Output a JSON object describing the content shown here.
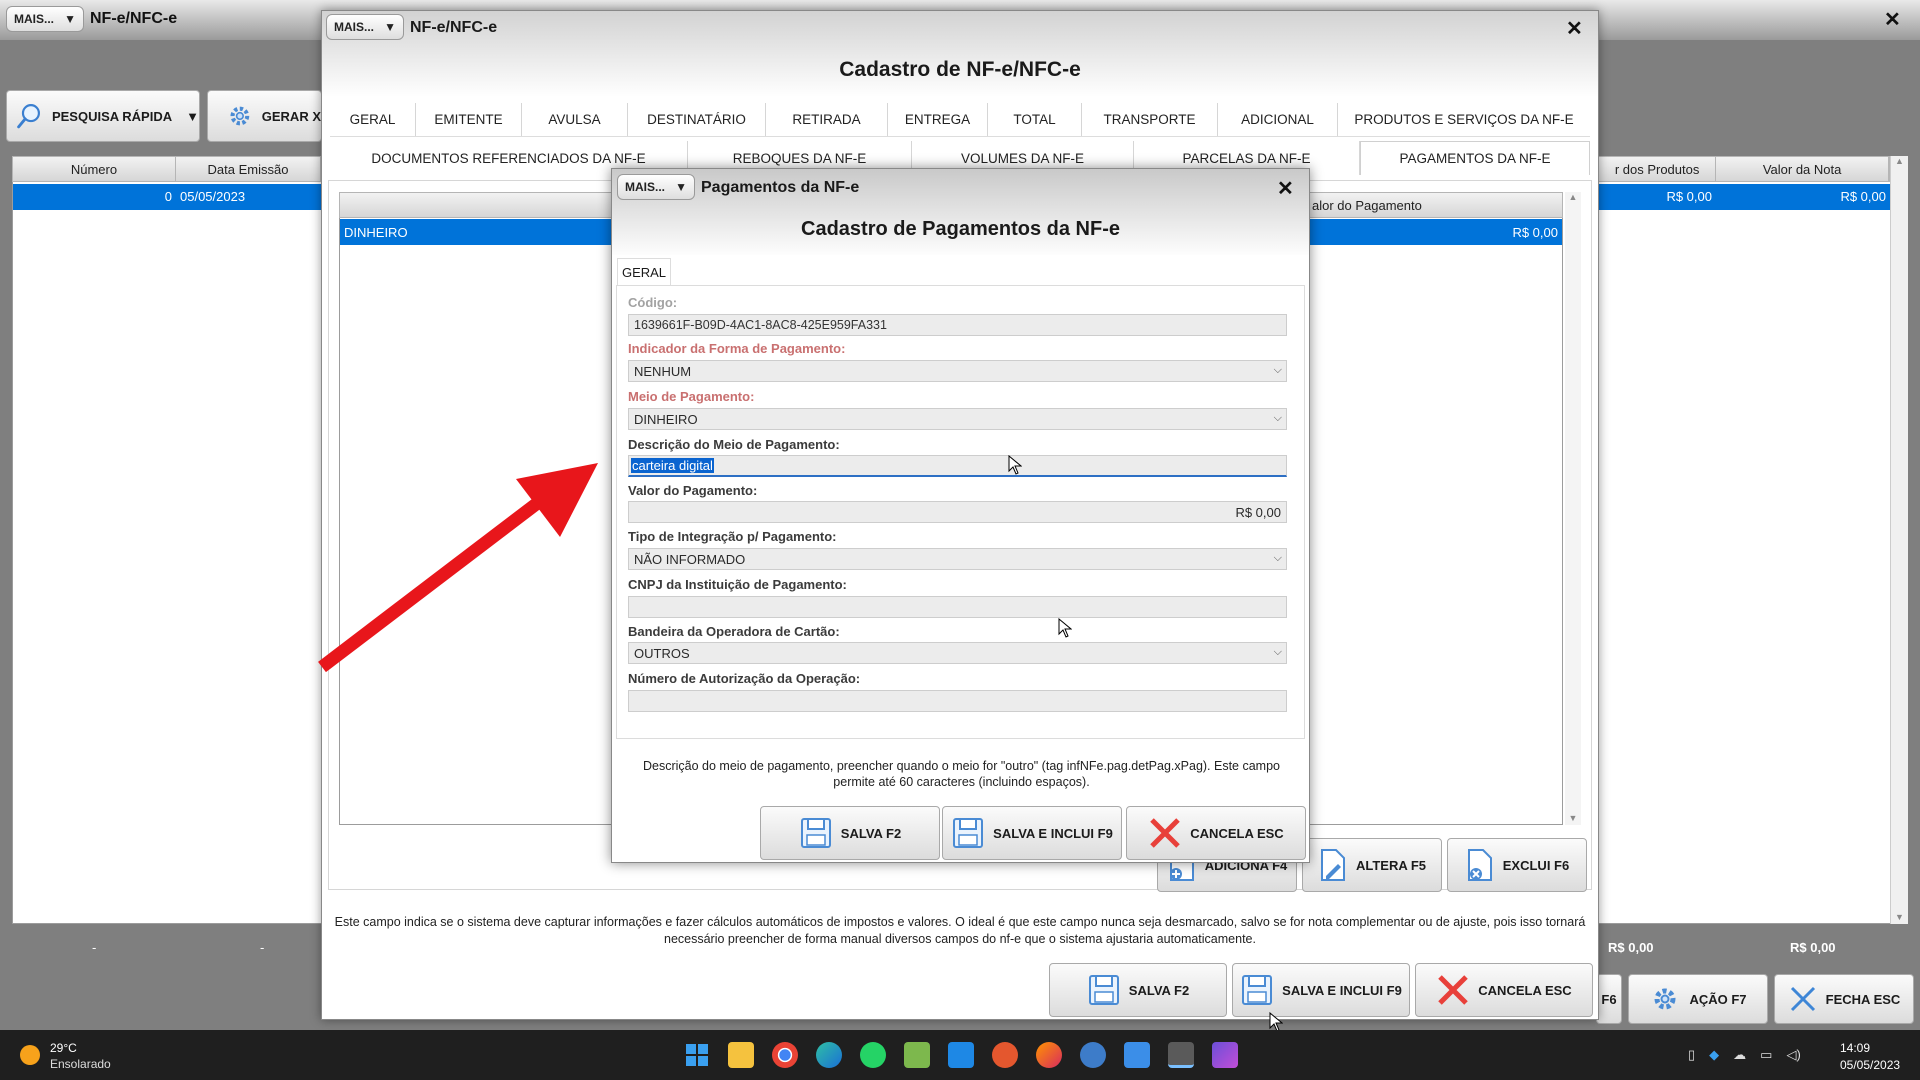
{
  "desktop": {
    "title": "NF-e/NFC-e",
    "mais": "MAIS...",
    "close": "✕"
  },
  "bg_toolbar": {
    "pesquisa": "PESQUISA RÁPIDA",
    "gerar": "GERAR X"
  },
  "bg_grid": {
    "headers": [
      "Número",
      "Data Emissão"
    ],
    "row": [
      "0",
      "05/05/2023"
    ],
    "right_headers": [
      "r dos Produtos",
      "Valor da Nota"
    ],
    "right_row": [
      "R$ 0,00",
      "R$ 0,00"
    ],
    "footer_left": [
      "-",
      "-"
    ],
    "footer_right": [
      "R$ 0,00",
      "R$ 0,00"
    ]
  },
  "bg_buttons": {
    "f6": "F6",
    "acao": "AÇÃO F7",
    "fecha": "FECHA ESC"
  },
  "nfe_dialog": {
    "mais": "MAIS...",
    "title": "NF-e/NFC-e",
    "heading": "Cadastro de NF-e/NFC-e",
    "close": "✕",
    "tabs_row1": [
      "GERAL",
      "EMITENTE",
      "AVULSA",
      "DESTINATÁRIO",
      "RETIRADA",
      "ENTREGA",
      "TOTAL",
      "TRANSPORTE",
      "ADICIONAL",
      "PRODUTOS E SERVIÇOS DA NF-E"
    ],
    "tabs_row2": [
      "DOCUMENTOS REFERENCIADOS DA NF-E",
      "REBOQUES DA NF-E",
      "VOLUMES DA NF-E",
      "PARCELAS DA NF-E",
      "PAGAMENTOS DA NF-E"
    ],
    "grid_header_right": "alor do Pagamento",
    "grid_row": {
      "meio": "DINHEIRO",
      "valor": "R$ 0,00"
    },
    "buttons": {
      "adiciona": "ADICIONA F4",
      "altera": "ALTERA F5",
      "exclui": "EXCLUI F6"
    },
    "hint": "Este campo indica se o sistema deve capturar informações e fazer cálculos automáticos de impostos e valores. O ideal é que este campo nunca seja desmarcado, salvo se for nota complementar ou de ajuste, pois isso tornará necessário preencher de forma manual diversos campos do nf-e que o sistema ajustaria automaticamente.",
    "footer": {
      "salva": "SALVA F2",
      "salva_inclui": "SALVA E INCLUI F9",
      "cancela": "CANCELA ESC"
    }
  },
  "pag_dialog": {
    "mais": "MAIS...",
    "title": "Pagamentos da NF-e",
    "heading": "Cadastro de Pagamentos da NF-e",
    "close": "✕",
    "tab": "GERAL",
    "fields": {
      "codigo_label": "Código:",
      "codigo": "1639661F-B09D-4AC1-8AC8-425E959FA331",
      "indicador_label": "Indicador da Forma de Pagamento:",
      "indicador": "NENHUM",
      "meio_label": "Meio de Pagamento:",
      "meio": "DINHEIRO",
      "descricao_label": "Descrição do Meio de Pagamento:",
      "descricao": "carteira digital",
      "valor_label": "Valor do Pagamento:",
      "valor": "R$ 0,00",
      "tipo_label": "Tipo de Integração p/ Pagamento:",
      "tipo": "NÃO INFORMADO",
      "cnpj_label": "CNPJ da Instituição de Pagamento:",
      "cnpj": "",
      "bandeira_label": "Bandeira da Operadora de Cartão:",
      "bandeira": "OUTROS",
      "autorizacao_label": "Número de Autorização da Operação:",
      "autorizacao": ""
    },
    "hint": "Descrição do meio de pagamento, preencher quando o meio for \"outro\" (tag infNFe.pag.detPag.xPag). Este campo permite até 60 caracteres (incluindo espaços).",
    "buttons": {
      "salva": "SALVA F2",
      "salva_inclui": "SALVA E INCLUI F9",
      "cancela": "CANCELA ESC"
    }
  },
  "taskbar": {
    "temp": "29°C",
    "weather": "Ensolarado",
    "time": "14:09",
    "date": "05/05/2023"
  },
  "colors": {
    "accent": "#0073d9",
    "arrow": "#e8161b",
    "required": "#c97070"
  }
}
